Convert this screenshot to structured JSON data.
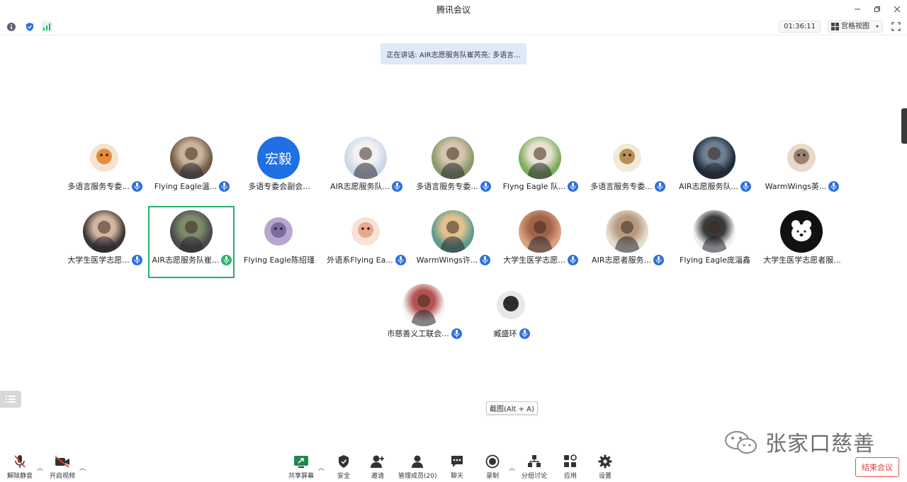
{
  "window": {
    "title": "腾讯会议"
  },
  "infobar": {
    "timer": "01:36:11",
    "view_mode": "宫格视图"
  },
  "speaking": {
    "text": "正在讲话: AIR志愿服务队崔芮亮; 多语言..."
  },
  "participants": [
    {
      "name": "多语言服务专委...",
      "mic": "blue",
      "avatar": "tiger-cartoon"
    },
    {
      "name": "Flying Eagle温...",
      "mic": "blue",
      "avatar": "photo"
    },
    {
      "name": "多语专委会副会...",
      "mic": "",
      "avatar": "text",
      "avatar_text": "宏毅"
    },
    {
      "name": "AIR志愿服务队...",
      "mic": "blue",
      "avatar": "photo"
    },
    {
      "name": "多语言服务专委...",
      "mic": "blue",
      "avatar": "photo"
    },
    {
      "name": "Flyng Eagle 队...",
      "mic": "blue",
      "avatar": "photo"
    },
    {
      "name": "多语言服务专委...",
      "mic": "blue",
      "avatar": "cartoon"
    },
    {
      "name": "AIR志愿服务队...",
      "mic": "blue",
      "avatar": "photo"
    },
    {
      "name": "WarmWings英...",
      "mic": "blue",
      "avatar": "anime"
    },
    {
      "name": "大学生医学志愿...",
      "mic": "blue",
      "avatar": "photo"
    },
    {
      "name": "AIR志愿服务队崔...",
      "mic": "green",
      "avatar": "photo",
      "active": true
    },
    {
      "name": "Flying Eagle陈绍瑾",
      "mic": "",
      "avatar": "cartoon"
    },
    {
      "name": "外语系Flying Ea...",
      "mic": "blue",
      "avatar": "cartoon"
    },
    {
      "name": "WarmWings许...",
      "mic": "blue",
      "avatar": "photo"
    },
    {
      "name": "大学生医学志愿...",
      "mic": "blue",
      "avatar": "photo"
    },
    {
      "name": "AIR志愿者服务...",
      "mic": "blue",
      "avatar": "photo"
    },
    {
      "name": "Flying Eagle庞淄鑫",
      "mic": "",
      "avatar": "photo"
    },
    {
      "name": "大学生医学志愿者服...",
      "mic": "",
      "avatar": "bear-logo"
    },
    {
      "name": "市慈善义工联会...",
      "mic": "blue",
      "avatar": "photo"
    },
    {
      "name": "臧盛环",
      "mic": "blue",
      "avatar": "cartoon"
    }
  ],
  "tooltip": {
    "text": "截图(Alt + A)"
  },
  "watermark": {
    "text": "张家口慈善"
  },
  "toolbar": {
    "unmute": "解除静音",
    "start_video": "开启视频",
    "share_screen": "共享屏幕",
    "security": "安全",
    "invite": "邀请",
    "manage_members": "管理成员(20)",
    "chat": "聊天",
    "record": "录制",
    "breakout": "分组讨论",
    "apps": "应用",
    "settings": "设置",
    "end_meeting": "结束会议"
  },
  "colors": {
    "accent": "#2f6fe0",
    "active_border": "#27b06c",
    "end_red": "#e03c3c",
    "speaking_bg": "#dfe9f7"
  }
}
